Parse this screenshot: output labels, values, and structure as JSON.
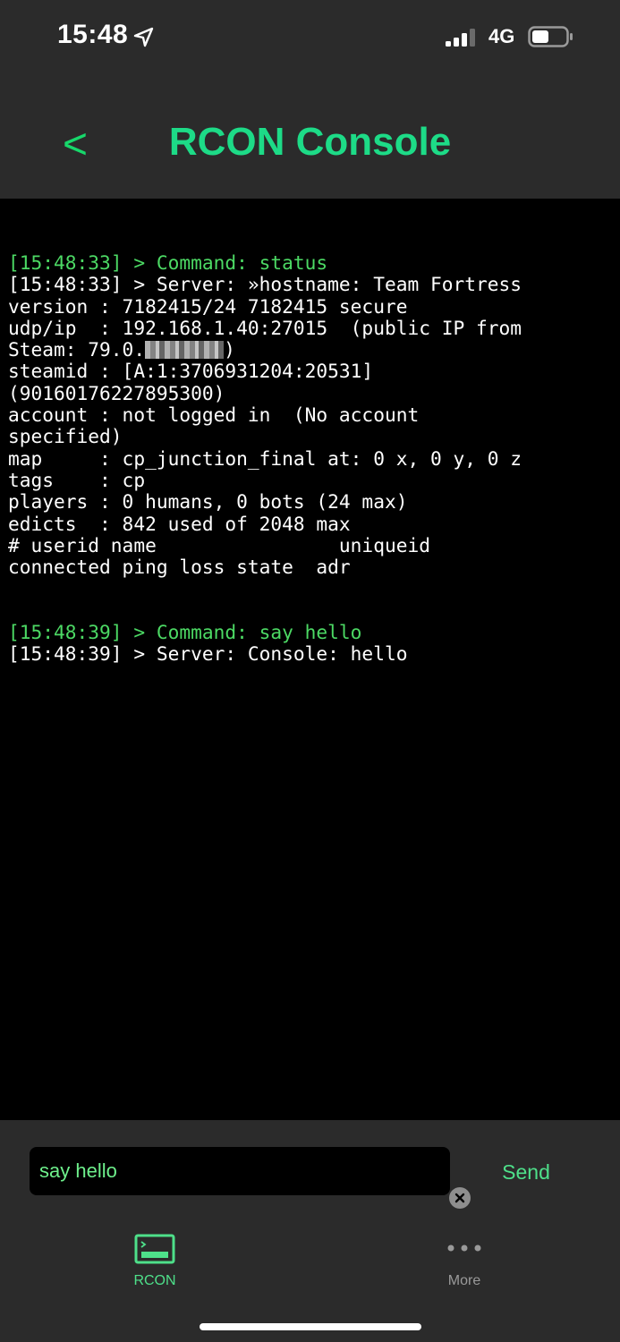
{
  "status_bar": {
    "time": "15:48",
    "network": "4G"
  },
  "header": {
    "back_label": "<",
    "title": "RCON Console"
  },
  "console": {
    "block1": {
      "command": "[15:48:33] > Command: status",
      "response_lines": [
        "[15:48:33] > Server: »hostname: Team Fortress",
        "version : 7182415/24 7182415 secure",
        "udp/ip  : 192.168.1.40:27015  (public IP from",
        "Steam: 79.0.",
        ")",
        "steamid : [A:1:3706931204:20531]",
        "(90160176227895300)",
        "account : not logged in  (No account",
        "specified)",
        "map     : cp_junction_final at: 0 x, 0 y, 0 z",
        "tags    : cp",
        "players : 0 humans, 0 bots (24 max)",
        "edicts  : 842 used of 2048 max",
        "# userid name                uniqueid",
        "connected ping loss state  adr"
      ]
    },
    "block2": {
      "command": "[15:48:39] > Command: say hello",
      "response_lines": [
        "[15:48:39] > Server: Console: hello"
      ]
    }
  },
  "input": {
    "value": "say hello",
    "send_label": "Send"
  },
  "tabs": [
    {
      "label": "RCON",
      "icon": "terminal-icon",
      "active": true
    },
    {
      "label": "More",
      "icon": "more-dots-icon",
      "active": false
    }
  ],
  "colors": {
    "accent": "#1ddb87",
    "command_text": "#4cd964",
    "chrome_bg": "#2b2b2b",
    "console_bg": "#000000"
  }
}
